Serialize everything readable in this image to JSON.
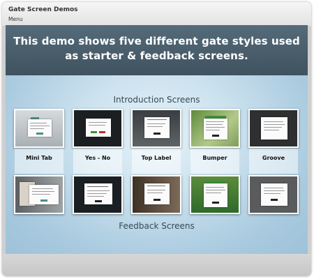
{
  "window": {
    "title": "Gate Screen Demos",
    "menu_label": "Menu"
  },
  "banner": {
    "text": "This demo shows five different gate styles used as starter & feedback screens."
  },
  "sections": {
    "introduction": "Introduction Screens",
    "feedback": "Feedback Screens"
  },
  "styles": [
    {
      "label": "Mini Tab",
      "intro_bg": "#bfc5c8",
      "feedback_bg": "#7a7e80"
    },
    {
      "label": "Yes - No",
      "intro_bg": "#1b1f22",
      "feedback_bg": "#1a1f23"
    },
    {
      "label": "Top Label",
      "intro_bg": "#4a4f52",
      "feedback_bg": "#5a4a3e"
    },
    {
      "label": "Bumper",
      "intro_bg": "#7d9b5a",
      "feedback_bg": "#6f9a4e"
    },
    {
      "label": "Groove",
      "intro_bg": "#2e2f31",
      "feedback_bg": "#5a5b5d"
    }
  ],
  "colors": {
    "banner": "#4a5e6b",
    "stage": "#b7d6e8",
    "accent_green": "#3f8f3a",
    "accent_red": "#b73232",
    "accent_teal": "#4d8c8a"
  }
}
